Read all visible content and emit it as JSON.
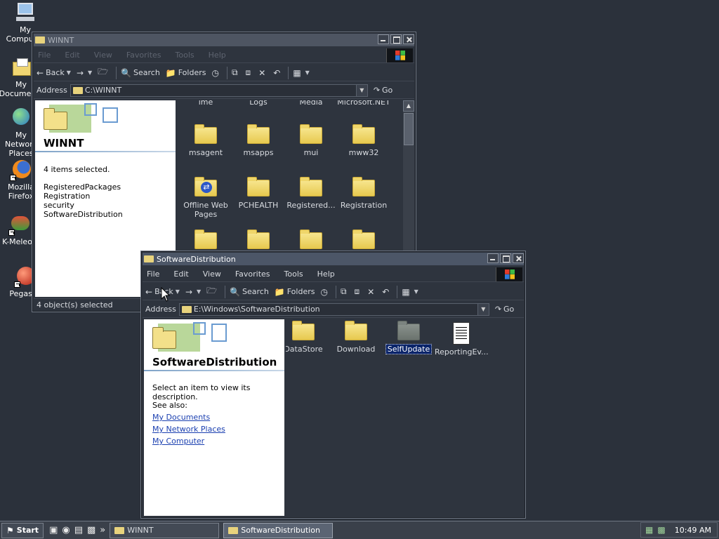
{
  "desktop": {
    "icons": [
      {
        "label": "My Computer"
      },
      {
        "label": "My Documents"
      },
      {
        "label": "My Network Places"
      },
      {
        "label": "Mozilla Firefox"
      },
      {
        "label": "K-Meleon"
      },
      {
        "label": "Pegasus"
      }
    ]
  },
  "window_winnt": {
    "title": "WINNT",
    "menu": [
      "File",
      "Edit",
      "View",
      "Favorites",
      "Tools",
      "Help"
    ],
    "toolbar": {
      "back": "Back",
      "search": "Search",
      "folders": "Folders"
    },
    "address": {
      "label": "Address",
      "value": "C:\\WINNT",
      "go": "Go"
    },
    "pane": {
      "title": "WINNT",
      "selected_count": "4 items selected.",
      "selected_items": [
        "RegisteredPackages",
        "Registration",
        "security",
        "SoftwareDistribution"
      ]
    },
    "items": [
      {
        "label": "ime"
      },
      {
        "label": "Logs"
      },
      {
        "label": "Media"
      },
      {
        "label": "Microsoft.NET"
      },
      {
        "label": "msagent"
      },
      {
        "label": "msapps"
      },
      {
        "label": "mui"
      },
      {
        "label": "mww32"
      },
      {
        "label": "Offline Web Pages"
      },
      {
        "label": "PCHEALTH"
      },
      {
        "label": "Registered..."
      },
      {
        "label": "Registration"
      }
    ],
    "status": "4 object(s) selected"
  },
  "window_sd": {
    "title": "SoftwareDistribution",
    "menu": [
      "File",
      "Edit",
      "View",
      "Favorites",
      "Tools",
      "Help"
    ],
    "toolbar": {
      "back": "Back",
      "search": "Search",
      "folders": "Folders"
    },
    "address": {
      "label": "Address",
      "value": "E:\\Windows\\SoftwareDistribution",
      "go": "Go"
    },
    "pane": {
      "title": "SoftwareDistribution",
      "description": "Select an item to view its description.",
      "see_also": "See also:",
      "links": [
        "My Documents",
        "My Network Places",
        "My Computer"
      ]
    },
    "items": [
      {
        "label": "DataStore"
      },
      {
        "label": "Download"
      },
      {
        "label": "SelfUpdate"
      },
      {
        "label": "ReportingEv..."
      }
    ]
  },
  "taskbar": {
    "start": "Start",
    "tasks": [
      "WINNT",
      "SoftwareDistribution"
    ],
    "clock": "10:49 AM"
  }
}
